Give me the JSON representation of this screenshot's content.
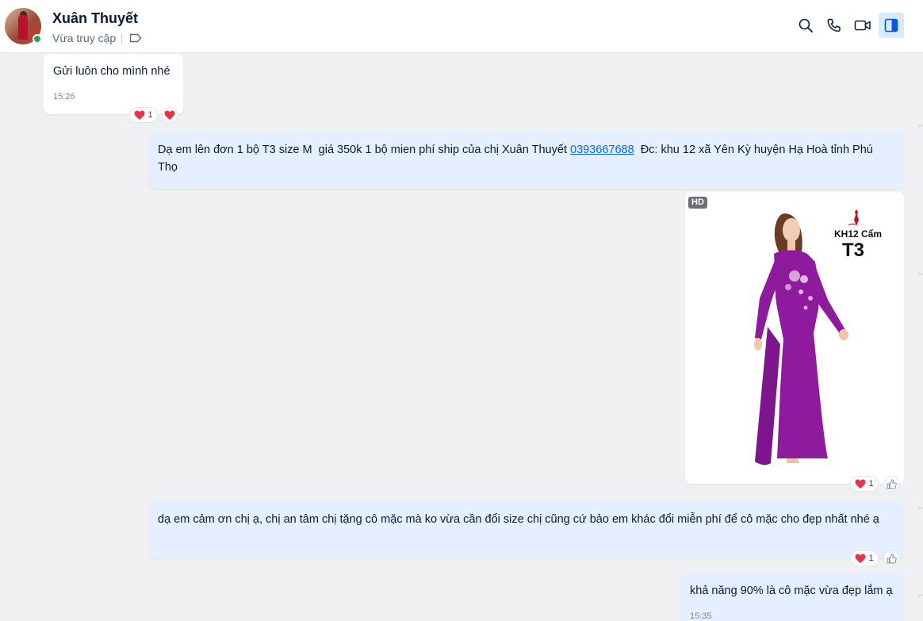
{
  "header": {
    "name": "Xuân Thuyết",
    "status": "Vừa truy cập",
    "icons": [
      "search-icon",
      "phone-icon",
      "video-icon",
      "sidebar-toggle-icon"
    ]
  },
  "messages": [
    {
      "direction": "incoming",
      "text": "Gửi luôn cho mình nhé",
      "time": "15:26",
      "reaction_count": "1"
    },
    {
      "direction": "outgoing",
      "text_before": "Dạ em lên đơn 1 bộ T3 size M  giá 350k 1 bộ mien phí ship của chị Xuân Thuyết ",
      "phone": "0393667688",
      "text_after": "  Đc: khu 12 xã Yên Kỳ huyện Hạ Hoà tỉnh Phú Thọ"
    },
    {
      "direction": "outgoing",
      "type": "image",
      "badge": "HD",
      "product_code": "KH12 Cẩm",
      "product_size": "T3",
      "reaction_count": "1"
    },
    {
      "direction": "outgoing",
      "text": "dạ em cảm ơn chị ạ, chị an tâm chị tặng cô mặc mà ko vừa cần đổi size chị cũng cứ bảo em khác đổi miễn phí để cô mặc cho đẹp nhất nhé ạ",
      "reaction_count": "1"
    },
    {
      "direction": "outgoing",
      "text": "khả năng 90% là cô mặc vừa đẹp lắm ạ",
      "time": "15:35"
    }
  ],
  "colors": {
    "outgoing_bubble": "#e5efff",
    "incoming_bubble": "#ffffff",
    "background": "#eef0f1",
    "accent": "#0068ff",
    "dress": "#8e1b9e"
  }
}
